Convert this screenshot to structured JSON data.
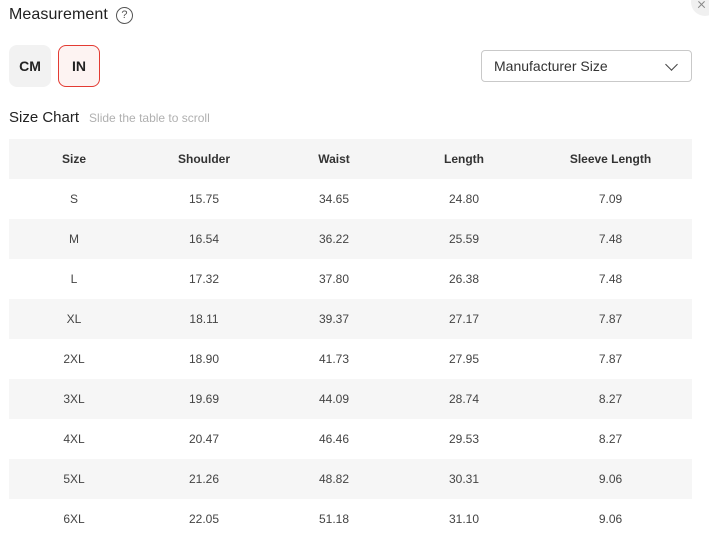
{
  "header": {
    "title": "Measurement",
    "help_glyph": "?"
  },
  "units": {
    "options": [
      "CM",
      "IN"
    ],
    "selected": "IN"
  },
  "size_select": {
    "value": "Manufacturer Size"
  },
  "size_chart": {
    "title": "Size Chart",
    "hint": "Slide the table to scroll",
    "columns": [
      "Size",
      "Shoulder",
      "Waist",
      "Length",
      "Sleeve Length"
    ],
    "rows": [
      [
        "S",
        "15.75",
        "34.65",
        "24.80",
        "7.09"
      ],
      [
        "M",
        "16.54",
        "36.22",
        "25.59",
        "7.48"
      ],
      [
        "L",
        "17.32",
        "37.80",
        "26.38",
        "7.48"
      ],
      [
        "XL",
        "18.11",
        "39.37",
        "27.17",
        "7.87"
      ],
      [
        "2XL",
        "18.90",
        "41.73",
        "27.95",
        "7.87"
      ],
      [
        "3XL",
        "19.69",
        "44.09",
        "28.74",
        "8.27"
      ],
      [
        "4XL",
        "20.47",
        "46.46",
        "29.53",
        "8.27"
      ],
      [
        "5XL",
        "21.26",
        "48.82",
        "30.31",
        "9.06"
      ],
      [
        "6XL",
        "22.05",
        "51.18",
        "31.10",
        "9.06"
      ]
    ]
  },
  "colors": {
    "accent": "#e33b33",
    "row_stripe": "#f6f6f6",
    "header_bg": "#f5f5f5"
  },
  "icons": {
    "help": "question-circle-icon",
    "dropdown": "chevron-down-icon",
    "close": "close-icon"
  }
}
